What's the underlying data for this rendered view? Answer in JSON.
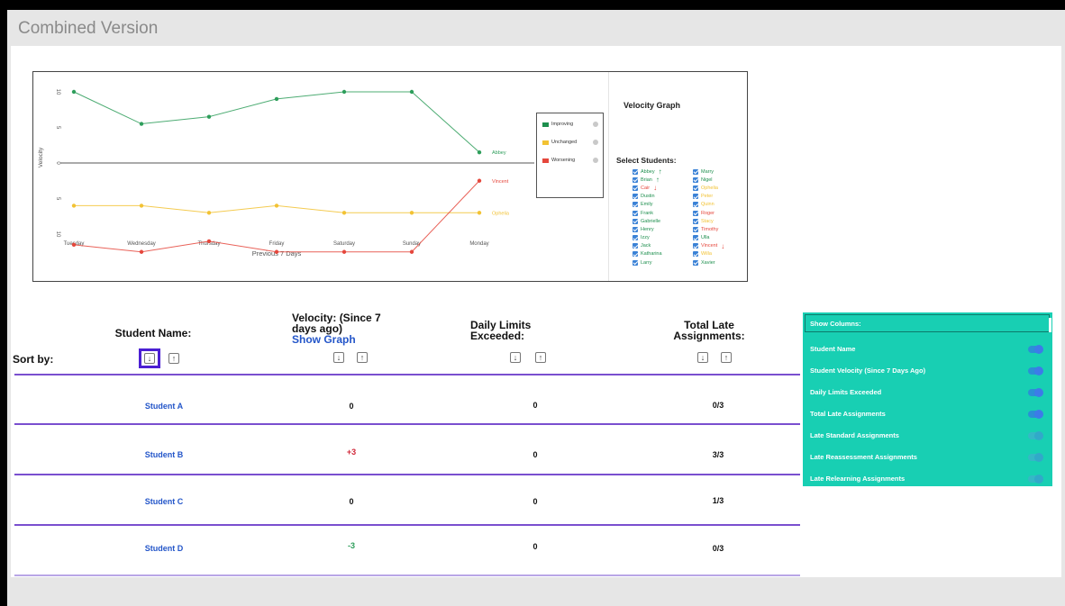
{
  "frame_title": "Combined Version",
  "chart": {
    "panel_title": "Velocity Graph",
    "select_title": "Select Students:",
    "legend": [
      {
        "label": "Improving",
        "color": "#1e8f4e"
      },
      {
        "label": "Unchanged",
        "color": "#f2c233"
      },
      {
        "label": "Worsening",
        "color": "#e5473c"
      }
    ],
    "students_col1": [
      {
        "name": "Abbey",
        "color": "#1e8f4e",
        "arrow": "↑"
      },
      {
        "name": "Brian",
        "color": "#1e8f4e",
        "arrow": "↑"
      },
      {
        "name": "Cair",
        "color": "#e5473c",
        "arrow": "↓"
      },
      {
        "name": "Dustin",
        "color": "#1e8f4e",
        "arrow": ""
      },
      {
        "name": "Emily",
        "color": "#1e8f4e",
        "arrow": ""
      },
      {
        "name": "Frank",
        "color": "#1e8f4e",
        "arrow": ""
      },
      {
        "name": "Gabrielle",
        "color": "#1e8f4e",
        "arrow": ""
      },
      {
        "name": "Henry",
        "color": "#1e8f4e",
        "arrow": ""
      },
      {
        "name": "Izzy",
        "color": "#1e8f4e",
        "arrow": ""
      },
      {
        "name": "Jack",
        "color": "#1e8f4e",
        "arrow": ""
      },
      {
        "name": "Katharina",
        "color": "#1e8f4e",
        "arrow": ""
      },
      {
        "name": "Larry",
        "color": "#1e8f4e",
        "arrow": ""
      }
    ],
    "students_col2": [
      {
        "name": "Marry",
        "color": "#1e8f4e",
        "arrow": ""
      },
      {
        "name": "Nigel",
        "color": "#1e8f4e",
        "arrow": ""
      },
      {
        "name": "Ophelia",
        "color": "#f2c233",
        "arrow": ""
      },
      {
        "name": "Peter",
        "color": "#f2c233",
        "arrow": ""
      },
      {
        "name": "Quinn",
        "color": "#f2c233",
        "arrow": ""
      },
      {
        "name": "Roger",
        "color": "#e5473c",
        "arrow": ""
      },
      {
        "name": "Stacy",
        "color": "#f2c233",
        "arrow": ""
      },
      {
        "name": "Timothy",
        "color": "#e5473c",
        "arrow": ""
      },
      {
        "name": "Ulla",
        "color": "#1e8f4e",
        "arrow": ""
      },
      {
        "name": "Vincent",
        "color": "#e5473c",
        "arrow": "↓"
      },
      {
        "name": "Willa",
        "color": "#f2c233",
        "arrow": ""
      },
      {
        "name": "Xavier",
        "color": "#1e8f4e",
        "arrow": ""
      }
    ]
  },
  "chart_data": {
    "type": "line",
    "xlabel": "Previous 7 Days",
    "ylabel": "Velocity",
    "categories": [
      "Tuesday",
      "Wednesday",
      "Thursday",
      "Friday",
      "Saturday",
      "Sunday",
      "Monday"
    ],
    "yticks": [
      "10",
      "5",
      "0",
      "5",
      "10"
    ],
    "ylim": [
      -10,
      10
    ],
    "series": [
      {
        "name": "Abbey",
        "color": "#2e9e5b",
        "values": [
          10,
          5.5,
          6.5,
          9,
          10,
          10,
          1.5
        ]
      },
      {
        "name": "Ophelia",
        "color": "#f2c233",
        "values": [
          -6,
          -6,
          -7,
          -6,
          -7,
          -7,
          -7
        ]
      },
      {
        "name": "Vincent",
        "color": "#e5473c",
        "values": [
          -11.5,
          -12.5,
          -11,
          -12.5,
          -12.5,
          -12.5,
          -2.5
        ]
      }
    ],
    "series_labels": [
      "Abbey",
      "Ophelia",
      "Vincent"
    ]
  },
  "table": {
    "sort_label": "Sort by:",
    "headers": {
      "name": "Student Name:",
      "velocity_line1": "Velocity: (Since 7",
      "velocity_line2": "days ago)",
      "show_graph": "Show Graph",
      "limits_line1": "Daily Limits",
      "limits_line2": "Exceeded:",
      "late_line1": "Total Late",
      "late_line2": "Assignments:"
    },
    "rows": [
      {
        "name": "Student A",
        "velocity": "0",
        "limits": "0",
        "late": "0/3"
      },
      {
        "name": "Student B",
        "velocity": "+3",
        "limits": "0",
        "late": "3/3"
      },
      {
        "name": "Student C",
        "velocity": "0",
        "limits": "0",
        "late": "1/3"
      },
      {
        "name": "Student D",
        "velocity": "-3",
        "limits": "0",
        "late": "0/3"
      }
    ]
  },
  "columns_panel": {
    "title": "Show Columns:",
    "items": [
      {
        "label": "Student Name",
        "on": true
      },
      {
        "label": "Student Velocity (Since 7 Days Ago)",
        "on": true
      },
      {
        "label": "Daily Limits Exceeded",
        "on": true
      },
      {
        "label": "Total Late Assignments",
        "on": true
      },
      {
        "label": "Late Standard Assignments",
        "on": false
      },
      {
        "label": "Late Reassessment Assignments",
        "on": false
      },
      {
        "label": "Late Relearning Assignments",
        "on": false
      }
    ]
  }
}
